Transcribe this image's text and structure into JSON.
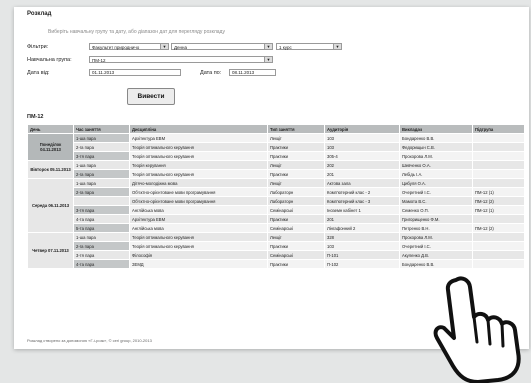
{
  "page": {
    "title": "Розклад",
    "hint": "Виберіть навчальну групу та дату, або діапазон дат для перегляду розкладу"
  },
  "form": {
    "filter_label": "Фільтри:",
    "filter_faculty": "Факультет природничо",
    "filter_form": "Денна",
    "filter_course": "1 курс",
    "group_label": "Навчальна група:",
    "group_value": "ПМ-12",
    "date_from_label": "Дата від:",
    "date_from": "01.11.2013",
    "date_to_label": "Дата по:",
    "date_to": "08.11.2013",
    "submit_label": "Вивести"
  },
  "group_title": "ПМ-12",
  "table": {
    "headers": [
      "День",
      "Час заняття",
      "Дисципліна",
      "Тип заняття",
      "Аудиторія",
      "Викладач",
      "Підгрупа"
    ],
    "days": [
      {
        "label": "Понеділок 04.11.2013",
        "rows": [
          [
            "1-ша пара",
            "Архітектура ЕВМ",
            "Лекції",
            "103",
            "Бондаренко В.В.",
            ""
          ],
          [
            "2-га пара",
            "Теорія оптимального керування",
            "Практики",
            "103",
            "Федорищын С.В.",
            ""
          ],
          [
            "3-тя пара",
            "Теорія оптимального керування",
            "Практики",
            "305-4",
            "Прохорова Л.М.",
            ""
          ]
        ]
      },
      {
        "label": "Вівторок 05.11.2013",
        "rows": [
          [
            "1-ша пара",
            "Теорія керування",
            "Лекції",
            "202",
            "Шевченко О.А.",
            ""
          ],
          [
            "2-га пара",
            "Теорія оптимального керування",
            "Практики",
            "201",
            "Лебідь І.А.",
            ""
          ]
        ]
      },
      {
        "label": "Середа 06.11.2013",
        "rows": [
          [
            "1-ша пара",
            "Дiтячо-молодiжна мова",
            "Лекції",
            "Актова зала",
            "Цибуля О.А.",
            ""
          ],
          [
            "2-га пара",
            "Об'єктно-орієнтоване мови програмування",
            "Лабораторн",
            "Комп'ютерний клас - 2",
            "Очеретний І.С.",
            "ПМ-12 (1)"
          ],
          [
            "",
            "Об'єктно-орієнтоване мови програмування",
            "Лабораторн",
            "Комп'ютерний клас - 3",
            "Мамота В.С.",
            "ПМ-12 (2)"
          ],
          [
            "3-тя пара",
            "Англійська мова",
            "Семінарські",
            "Іноземн кабінет 1",
            "Семенко О.П.",
            "ПМ-12 (1)"
          ],
          [
            "4-та пара",
            "Архітектура ЕВМ",
            "Практики",
            "201",
            "Григорищенко Ф.М.",
            ""
          ],
          [
            "5-та пара",
            "Англійська мова",
            "Семінарські",
            "Лінгафонний 2",
            "Петренко В.Н.",
            "ПМ-12 (2)"
          ]
        ]
      },
      {
        "label": "Четвер 07.11.2013",
        "rows": [
          [
            "1-ша пара",
            "Теорія оптимального керування",
            "Лекції",
            "328",
            "Прохорова Л.М.",
            ""
          ],
          [
            "2-га пара",
            "Теорія оптимального керування",
            "Практики",
            "103",
            "Очеретний І.С.",
            ""
          ],
          [
            "3-тя пара",
            "Філософія",
            "Семінарські",
            "П-101",
            "Акуленко Д.В.",
            ""
          ],
          [
            "4-та пара",
            "ЗЕМД",
            "Практики",
            "П-102",
            "Бондаренко В.В.",
            ""
          ]
        ]
      }
    ]
  },
  "footer": "Розклад створено за допомогою «Г-і-розк», © ceri group, 2010-2013",
  "colors": {
    "header_bg": "#b9bcbd",
    "day_bg": "#b4b8b9",
    "row_bg": "#f3f3f3",
    "row_alt_bg": "#e7e7e7"
  },
  "icons": {
    "cursor": "hand-pointer-icon"
  }
}
